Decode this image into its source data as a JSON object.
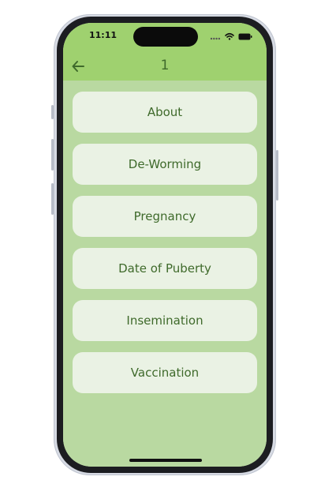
{
  "status_bar": {
    "time": "11:11"
  },
  "app_bar": {
    "title": "1",
    "back_icon": "arrow-left-icon"
  },
  "menu": {
    "items": [
      {
        "label": "About"
      },
      {
        "label": "De-Worming"
      },
      {
        "label": "Pregnancy"
      },
      {
        "label": "Date of Puberty"
      },
      {
        "label": "Insemination"
      },
      {
        "label": "Vaccination"
      }
    ]
  },
  "colors": {
    "app_bar": "#9fd16f",
    "background": "#b9d9a1",
    "button": "#eaf2e4",
    "text": "#3f6a2b"
  }
}
